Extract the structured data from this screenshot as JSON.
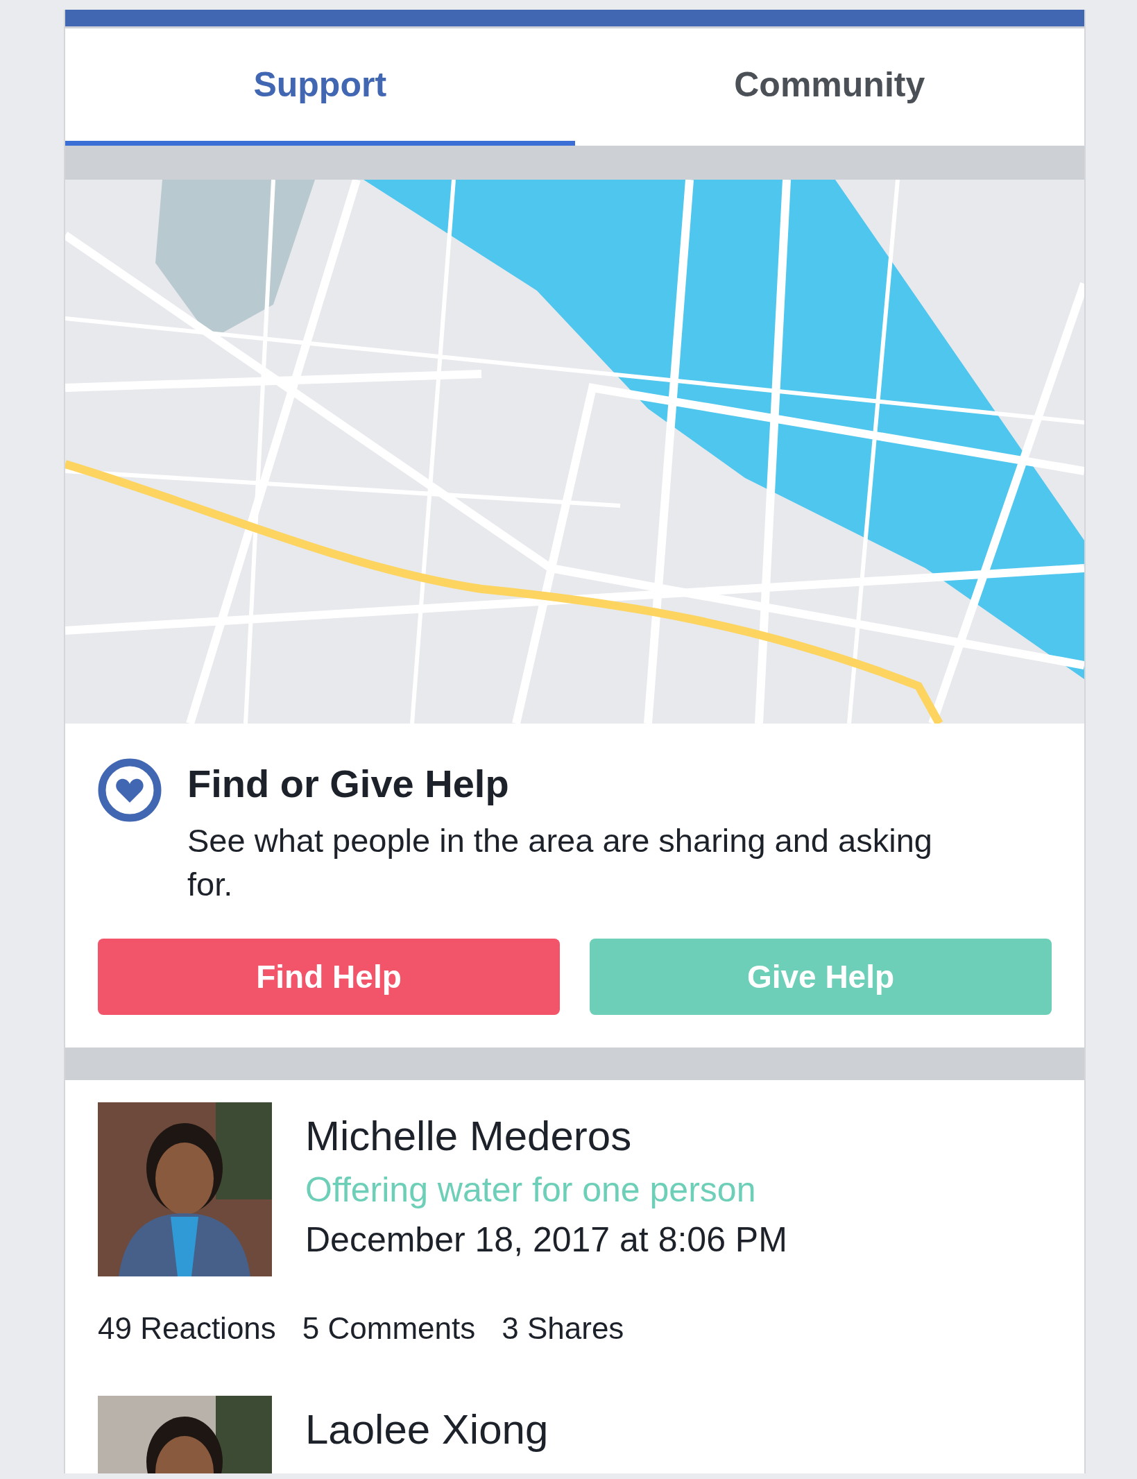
{
  "tabs": [
    {
      "label": "Support",
      "selected": true
    },
    {
      "label": "Community",
      "selected": false
    }
  ],
  "help_card": {
    "title": "Find or Give Help",
    "description": "See what people in the area are sharing and asking for.",
    "buttons": [
      {
        "label": "Find Help",
        "kind": "find"
      },
      {
        "label": "Give Help",
        "kind": "give"
      }
    ]
  },
  "posts": [
    {
      "author": "Michelle Mederos",
      "offer": "Offering water for one person",
      "time": "December 18, 2017 at 8:06 PM",
      "stats": [
        "49 Reactions",
        "5 Comments",
        "3 Shares"
      ]
    },
    {
      "author": "Laolee Xiong"
    }
  ]
}
